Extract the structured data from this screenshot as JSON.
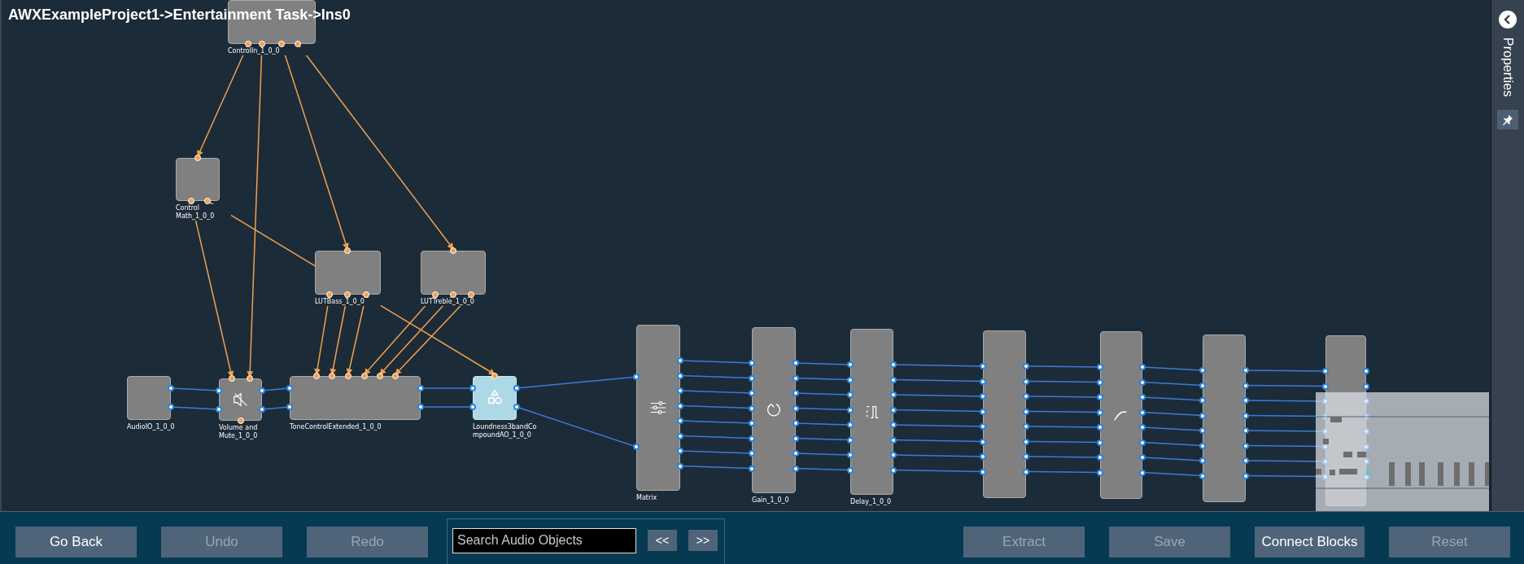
{
  "title": "AWXExampleProject1->Entertainment Task->Ins0",
  "blocks": [
    {
      "label": "ControlIn_1_0_0",
      "kind": "plain",
      "selected": false
    },
    {
      "label": "Control Math_1_0_0",
      "kind": "plain",
      "selected": false
    },
    {
      "label": "LUTBass_1_0_0",
      "kind": "plain",
      "selected": false
    },
    {
      "label": "LUTTreble_1_0_0",
      "kind": "plain",
      "selected": false
    },
    {
      "label": "AudioIO_1_0_0",
      "kind": "plain",
      "selected": false
    },
    {
      "label": "Volume and Mute_1_0_0",
      "kind": "mute",
      "selected": false
    },
    {
      "label": "ToneControlExtended_1_0_0",
      "kind": "plain",
      "selected": false
    },
    {
      "label": "Loundness3bandCompoundAO_1_0_0",
      "kind": "shapes",
      "selected": true
    },
    {
      "label": "Matrix",
      "kind": "sliders",
      "selected": false
    },
    {
      "label": "Gain_1_0_0",
      "kind": "gain",
      "selected": false
    },
    {
      "label": "Delay_1_0_0",
      "kind": "delay",
      "selected": false
    },
    {
      "kind": "plain",
      "selected": false
    },
    {
      "kind": "curve",
      "selected": false
    },
    {
      "kind": "plain",
      "selected": false
    },
    {
      "kind": "plain",
      "selected": false
    }
  ],
  "sidebar": {
    "title": "Properties"
  },
  "toolbar": {
    "buttons_left": [
      {
        "label": "Go Back",
        "disabled": false
      },
      {
        "label": "Undo",
        "disabled": true
      },
      {
        "label": "Redo",
        "disabled": true
      }
    ],
    "search": {
      "placeholder": "Search Audio Objects"
    },
    "nav_buttons": [
      "<<",
      ">>"
    ],
    "buttons_right": [
      {
        "label": "Extract",
        "disabled": true
      },
      {
        "label": "Save",
        "disabled": true
      },
      {
        "label": "Connect Blocks",
        "disabled": false
      },
      {
        "label": "Reset",
        "disabled": true
      }
    ]
  }
}
